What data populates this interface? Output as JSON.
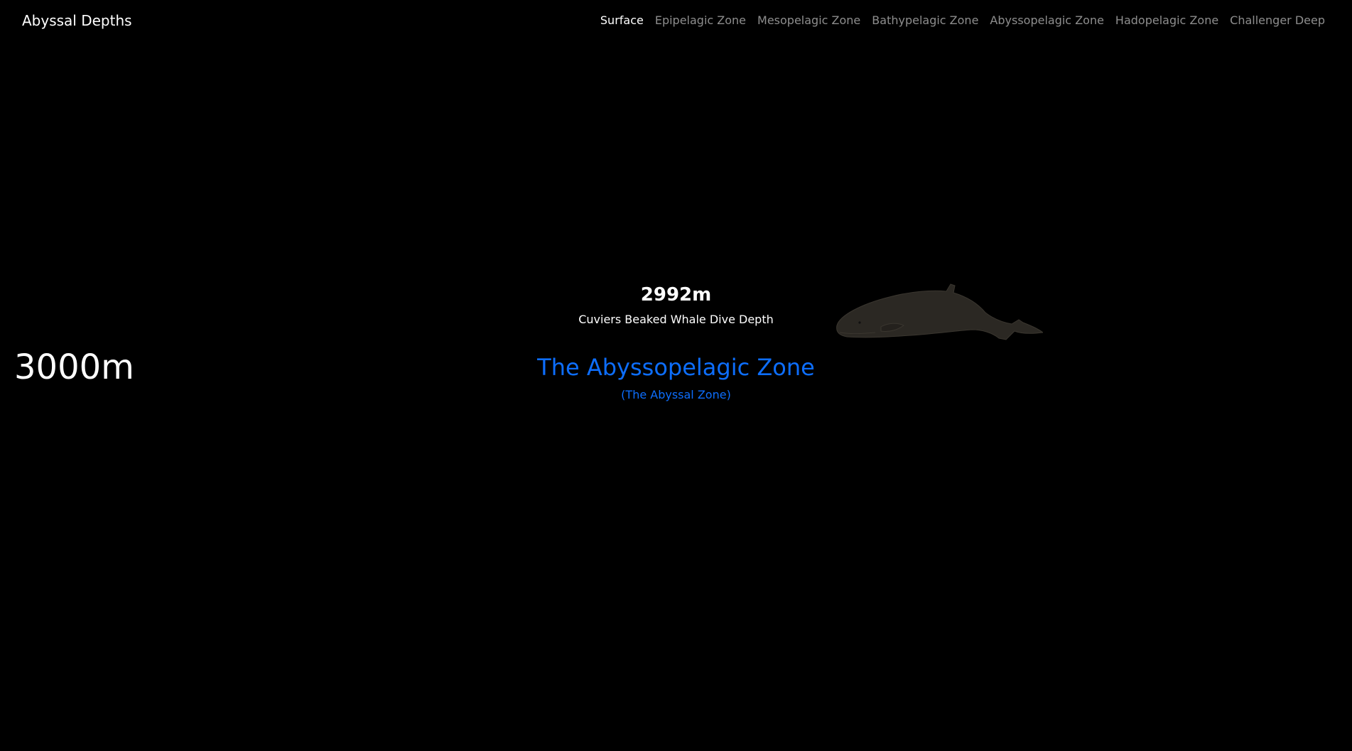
{
  "nav": {
    "brand": "Abyssal Depths",
    "links": [
      {
        "label": "Surface",
        "active": true
      },
      {
        "label": "Epipelagic Zone",
        "active": false
      },
      {
        "label": "Mesopelagic Zone",
        "active": false
      },
      {
        "label": "Bathypelagic Zone",
        "active": false
      },
      {
        "label": "Abyssopelagic Zone",
        "active": false
      },
      {
        "label": "Hadopelagic Zone",
        "active": false
      },
      {
        "label": "Challenger Deep",
        "active": false
      }
    ]
  },
  "depth_marker": "3000m",
  "creature": {
    "depth": "2992m",
    "name": "Cuviers Beaked Whale Dive Depth",
    "icon": "whale-icon"
  },
  "zone": {
    "title": "The Abyssopelagic Zone",
    "subtitle": "(The Abyssal Zone)"
  },
  "colors": {
    "background": "#000000",
    "accent": "#0d6efd",
    "nav_inactive": "rgba(255,255,255,0.55)",
    "whale": "#2b2823"
  }
}
